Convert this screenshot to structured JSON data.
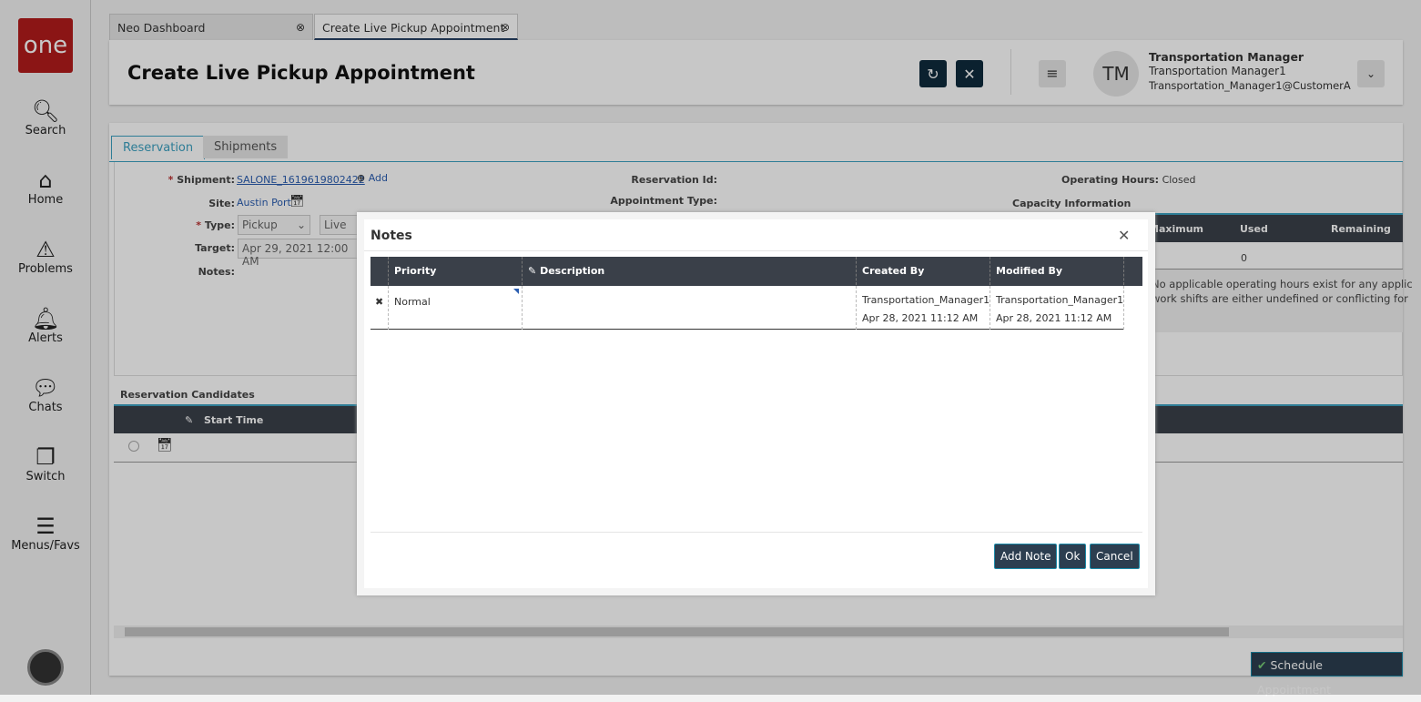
{
  "sidebar": {
    "logo": "one",
    "items": [
      {
        "label": "Search",
        "icon": "search-icon"
      },
      {
        "label": "Home",
        "icon": "home-icon"
      },
      {
        "label": "Problems",
        "icon": "warning-icon"
      },
      {
        "label": "Alerts",
        "icon": "bell-icon"
      },
      {
        "label": "Chats",
        "icon": "chat-icon"
      },
      {
        "label": "Switch",
        "icon": "switch-icon"
      },
      {
        "label": "Menus/Favs",
        "icon": "menu-icon"
      }
    ]
  },
  "tabs": [
    {
      "label": "Neo Dashboard"
    },
    {
      "label": "Create Live Pickup Appointment"
    }
  ],
  "header": {
    "title": "Create Live Pickup Appointment",
    "avatar": "TM",
    "user_role": "Transportation Manager",
    "user_name": "Transportation Manager1",
    "user_email": "Transportation_Manager1@CustomerA"
  },
  "form": {
    "tabs": [
      "Reservation",
      "Shipments"
    ],
    "shipment_label": "Shipment:",
    "shipment_value": "SALONE_1619619802422",
    "add_label": "Add",
    "site_label": "Site:",
    "site_value": "Austin Port",
    "type_label": "Type:",
    "type_value": "Pickup",
    "type2_value": "Live",
    "target_label": "Target:",
    "target_value": "Apr 29, 2021 12:00 AM",
    "notes_label": "Notes:",
    "reservation_id_label": "Reservation Id:",
    "appointment_type_label": "Appointment Type:",
    "operating_hours_label": "Operating Hours:",
    "operating_hours_value": "Closed",
    "capacity_title": "Capacity Information",
    "capacity_headers": [
      "Maximum",
      "Used",
      "Remaining"
    ],
    "capacity_used": "0",
    "capacity_message_1": "No applicable operating hours exist for any applic",
    "capacity_message_2": "work shifts are either undefined or conflicting for",
    "candidates_title": "Reservation Candidates",
    "candidates_header": "Start Time",
    "schedule_button": "Schedule Appointment"
  },
  "modal": {
    "title": "Notes",
    "headers": [
      "Priority",
      "Description",
      "Created By",
      "Modified By"
    ],
    "rows": [
      {
        "priority": "Normal",
        "description": "",
        "created_by": "Transportation_Manager1",
        "created_at": "Apr 28, 2021 11:12 AM",
        "modified_by": "Transportation_Manager1",
        "modified_at": "Apr 28, 2021 11:12 AM"
      }
    ],
    "buttons": {
      "add_note": "Add Note",
      "ok": "Ok",
      "cancel": "Cancel"
    }
  }
}
